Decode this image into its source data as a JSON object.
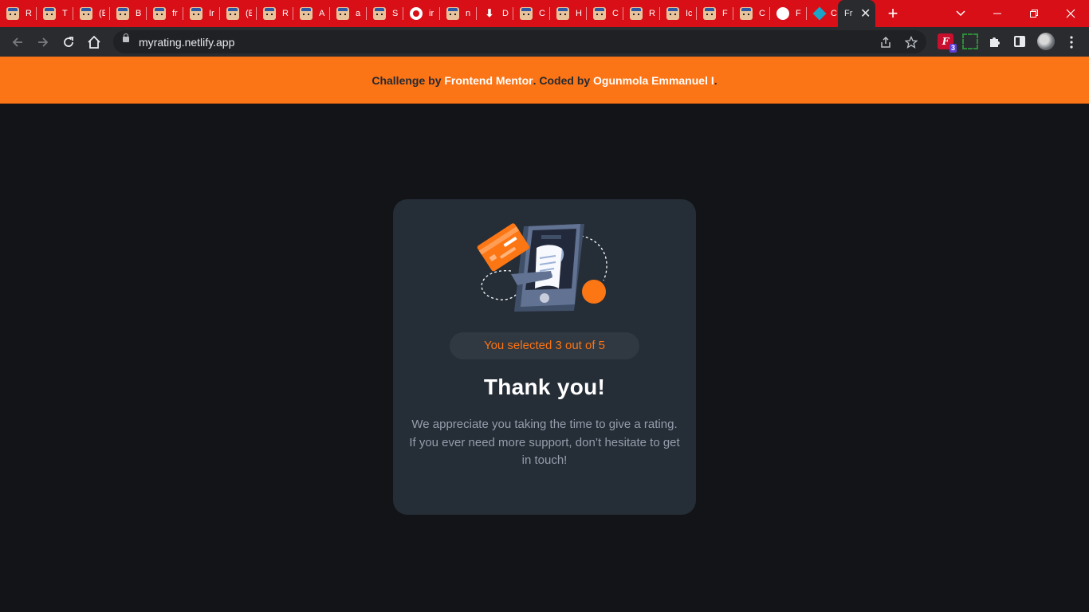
{
  "browser": {
    "tabs": [
      {
        "favicon": "avatar-icon",
        "title": "R"
      },
      {
        "favicon": "avatar-icon",
        "title": "T"
      },
      {
        "favicon": "avatar-icon",
        "title": "(E"
      },
      {
        "favicon": "avatar-icon",
        "title": "B"
      },
      {
        "favicon": "avatar-icon",
        "title": "fr"
      },
      {
        "favicon": "avatar-icon",
        "title": "Ir"
      },
      {
        "favicon": "avatar-icon",
        "title": "(E"
      },
      {
        "favicon": "avatar-icon",
        "title": "R"
      },
      {
        "favicon": "avatar-icon",
        "title": "A"
      },
      {
        "favicon": "avatar-icon",
        "title": "a"
      },
      {
        "favicon": "avatar-icon",
        "title": "S"
      },
      {
        "favicon": "github-icon",
        "title": "ir"
      },
      {
        "favicon": "avatar-icon",
        "title": "n"
      },
      {
        "favicon": "download-icon",
        "title": "D"
      },
      {
        "favicon": "avatar-icon",
        "title": "C"
      },
      {
        "favicon": "avatar-icon",
        "title": "H"
      },
      {
        "favicon": "avatar-icon",
        "title": "C"
      },
      {
        "favicon": "avatar-icon",
        "title": "R"
      },
      {
        "favicon": "avatar-icon",
        "title": "Ic"
      },
      {
        "favicon": "avatar-icon",
        "title": "F"
      },
      {
        "favicon": "avatar-icon",
        "title": "C"
      },
      {
        "favicon": "white-circle-icon",
        "title": "F"
      },
      {
        "favicon": "diamond-icon",
        "title": "C"
      }
    ],
    "active_tab": {
      "title": "Fr",
      "close": "✕"
    },
    "new_tab": "+",
    "address": "myrating.netlify.app",
    "extension_badge": "3",
    "colors": {
      "tabstrip": "#d80f17",
      "toolbar": "#2a2b2f"
    }
  },
  "attribution": {
    "prefix": "Challenge by ",
    "mentor": "Frontend Mentor",
    "middle": ". Coded by ",
    "author": "Ogunmola Emmanuel I",
    "suffix": "."
  },
  "card": {
    "illustration": "payment-phone-illustration",
    "selected_text": "You selected 3 out of 5",
    "title": "Thank you!",
    "description": "We appreciate you taking the time to give a rating. If you ever need more support, don’t hesitate to get in touch!"
  },
  "colors": {
    "accent": "#fb7413",
    "background": "#121417",
    "card": "#252d37",
    "pill": "#303841",
    "text_muted": "#959eac"
  }
}
